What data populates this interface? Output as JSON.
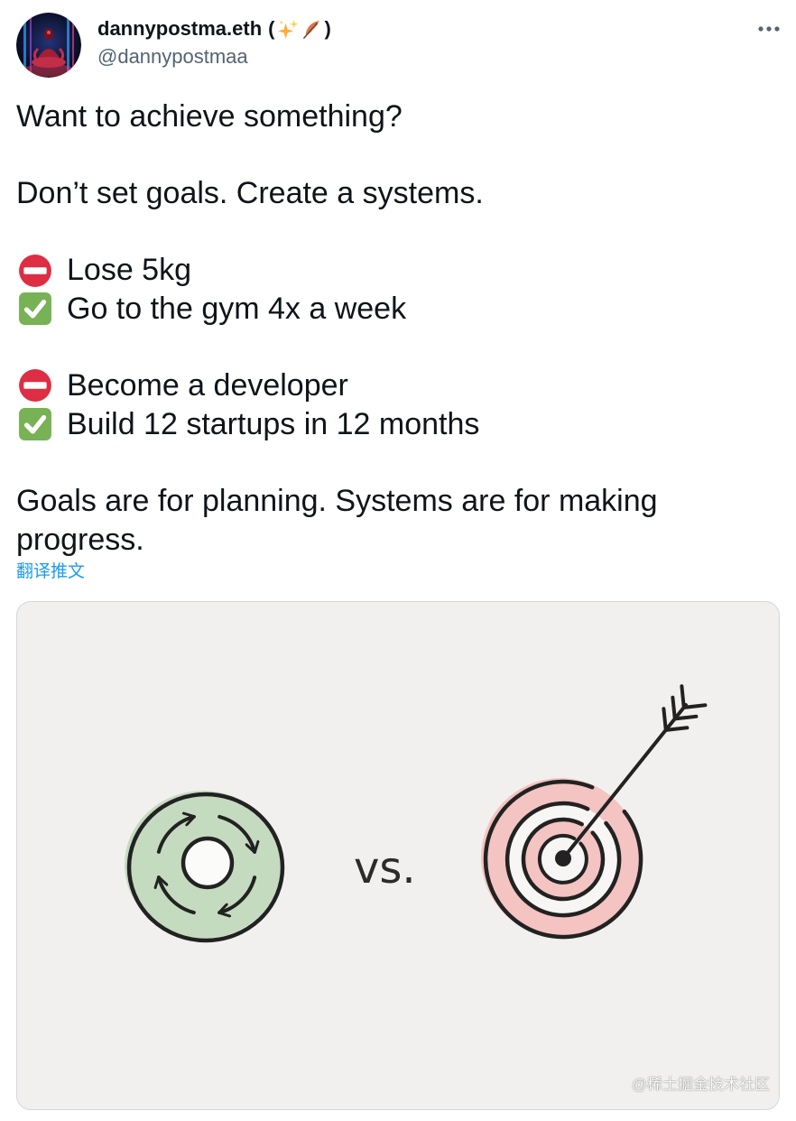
{
  "tweet": {
    "author": {
      "avatar": "avatar-image",
      "display_name": "dannypostma.eth",
      "name_open": "(",
      "name_emojis": [
        "sparkles-icon",
        "feather-icon"
      ],
      "name_close": ")",
      "handle": "@dannypostmaa"
    },
    "more_icon": "more-icon",
    "text": {
      "intro": "Want to achieve something?",
      "thesis": "Don’t set goals. Create a systems.",
      "examples": [
        [
          {
            "icon": "no-entry-icon",
            "text": "Lose 5kg"
          },
          {
            "icon": "check-mark-icon",
            "text": "Go to the gym 4x a week"
          }
        ],
        [
          {
            "icon": "no-entry-icon",
            "text": "Become a developer"
          },
          {
            "icon": "check-mark-icon",
            "text": "Build 12 startups in 12 months"
          }
        ]
      ],
      "closing": "Goals are for planning. Systems are for making progress."
    },
    "translate_link": "翻译推文",
    "media": {
      "left_icon": "cycle-arrows-icon",
      "vs_label": "vs.",
      "right_icon": "target-arrow-icon",
      "watermark": "@稀土掘金技术社区"
    }
  },
  "colors": {
    "text": "#0f1419",
    "secondary_text": "#536471",
    "link": "#1d9bf0",
    "no_entry_red": "#dd2e44",
    "check_green": "#77b255",
    "cycle_green": "#c5dbbf",
    "target_pink": "#f3c4c2",
    "media_background": "#f1f0ee"
  }
}
